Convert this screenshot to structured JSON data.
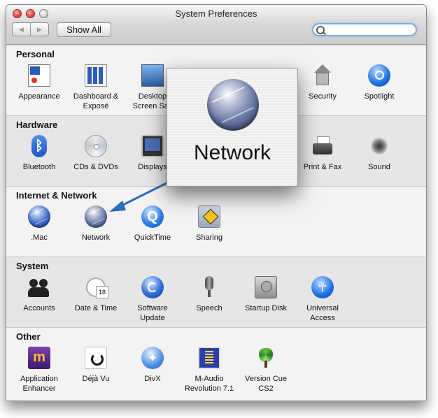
{
  "window": {
    "title": "System Preferences",
    "show_all_label": "Show All",
    "nav_back": "◀",
    "nav_forward": "▶",
    "search_value": ""
  },
  "sections": [
    {
      "title": "Personal",
      "items": [
        {
          "label": "Appearance",
          "icon": "appearance-icon"
        },
        {
          "label": "Dashboard &\nExposé",
          "icon": "dashboard-icon"
        },
        {
          "label": "Desktop\nScreen Sav",
          "icon": "desktop-icon"
        },
        {
          "label": "Security",
          "icon": "security-icon"
        },
        {
          "label": "Spotlight",
          "icon": "spotlight-icon"
        }
      ]
    },
    {
      "title": "Hardware",
      "items": [
        {
          "label": "Bluetooth",
          "icon": "bluetooth-icon"
        },
        {
          "label": "CDs & DVDs",
          "icon": "cd-dvd-icon"
        },
        {
          "label": "Displays",
          "icon": "displays-icon"
        },
        {
          "label": "Print & Fax",
          "icon": "printer-icon"
        },
        {
          "label": "Sound",
          "icon": "speaker-icon"
        }
      ]
    },
    {
      "title": "Internet & Network",
      "items": [
        {
          "label": ".Mac",
          "icon": "dotmac-globe-icon"
        },
        {
          "label": "Network",
          "icon": "network-globe-icon"
        },
        {
          "label": "QuickTime",
          "icon": "quicktime-icon"
        },
        {
          "label": "Sharing",
          "icon": "sharing-folder-icon"
        }
      ]
    },
    {
      "title": "System",
      "items": [
        {
          "label": "Accounts",
          "icon": "accounts-icon"
        },
        {
          "label": "Date & Time",
          "icon": "clock-icon"
        },
        {
          "label": "Software\nUpdate",
          "icon": "software-update-icon"
        },
        {
          "label": "Speech",
          "icon": "microphone-icon"
        },
        {
          "label": "Startup Disk",
          "icon": "hard-disk-icon"
        },
        {
          "label": "Universal\nAccess",
          "icon": "accessibility-icon"
        }
      ]
    },
    {
      "title": "Other",
      "items": [
        {
          "label": "Application\nEnhancer",
          "icon": "application-enhancer-icon"
        },
        {
          "label": "Déjà Vu",
          "icon": "deja-vu-icon"
        },
        {
          "label": "DivX",
          "icon": "divx-icon"
        },
        {
          "label": "M-Audio\nRevolution 7.1",
          "icon": "m-audio-icon"
        },
        {
          "label": "Version Cue\nCS2",
          "icon": "version-cue-icon"
        }
      ]
    }
  ],
  "zoom_callout": {
    "label": "Network",
    "icon": "network-globe-icon"
  },
  "colors": {
    "arrow": "#2c6fb8",
    "search_focus": "#7eaadd"
  }
}
